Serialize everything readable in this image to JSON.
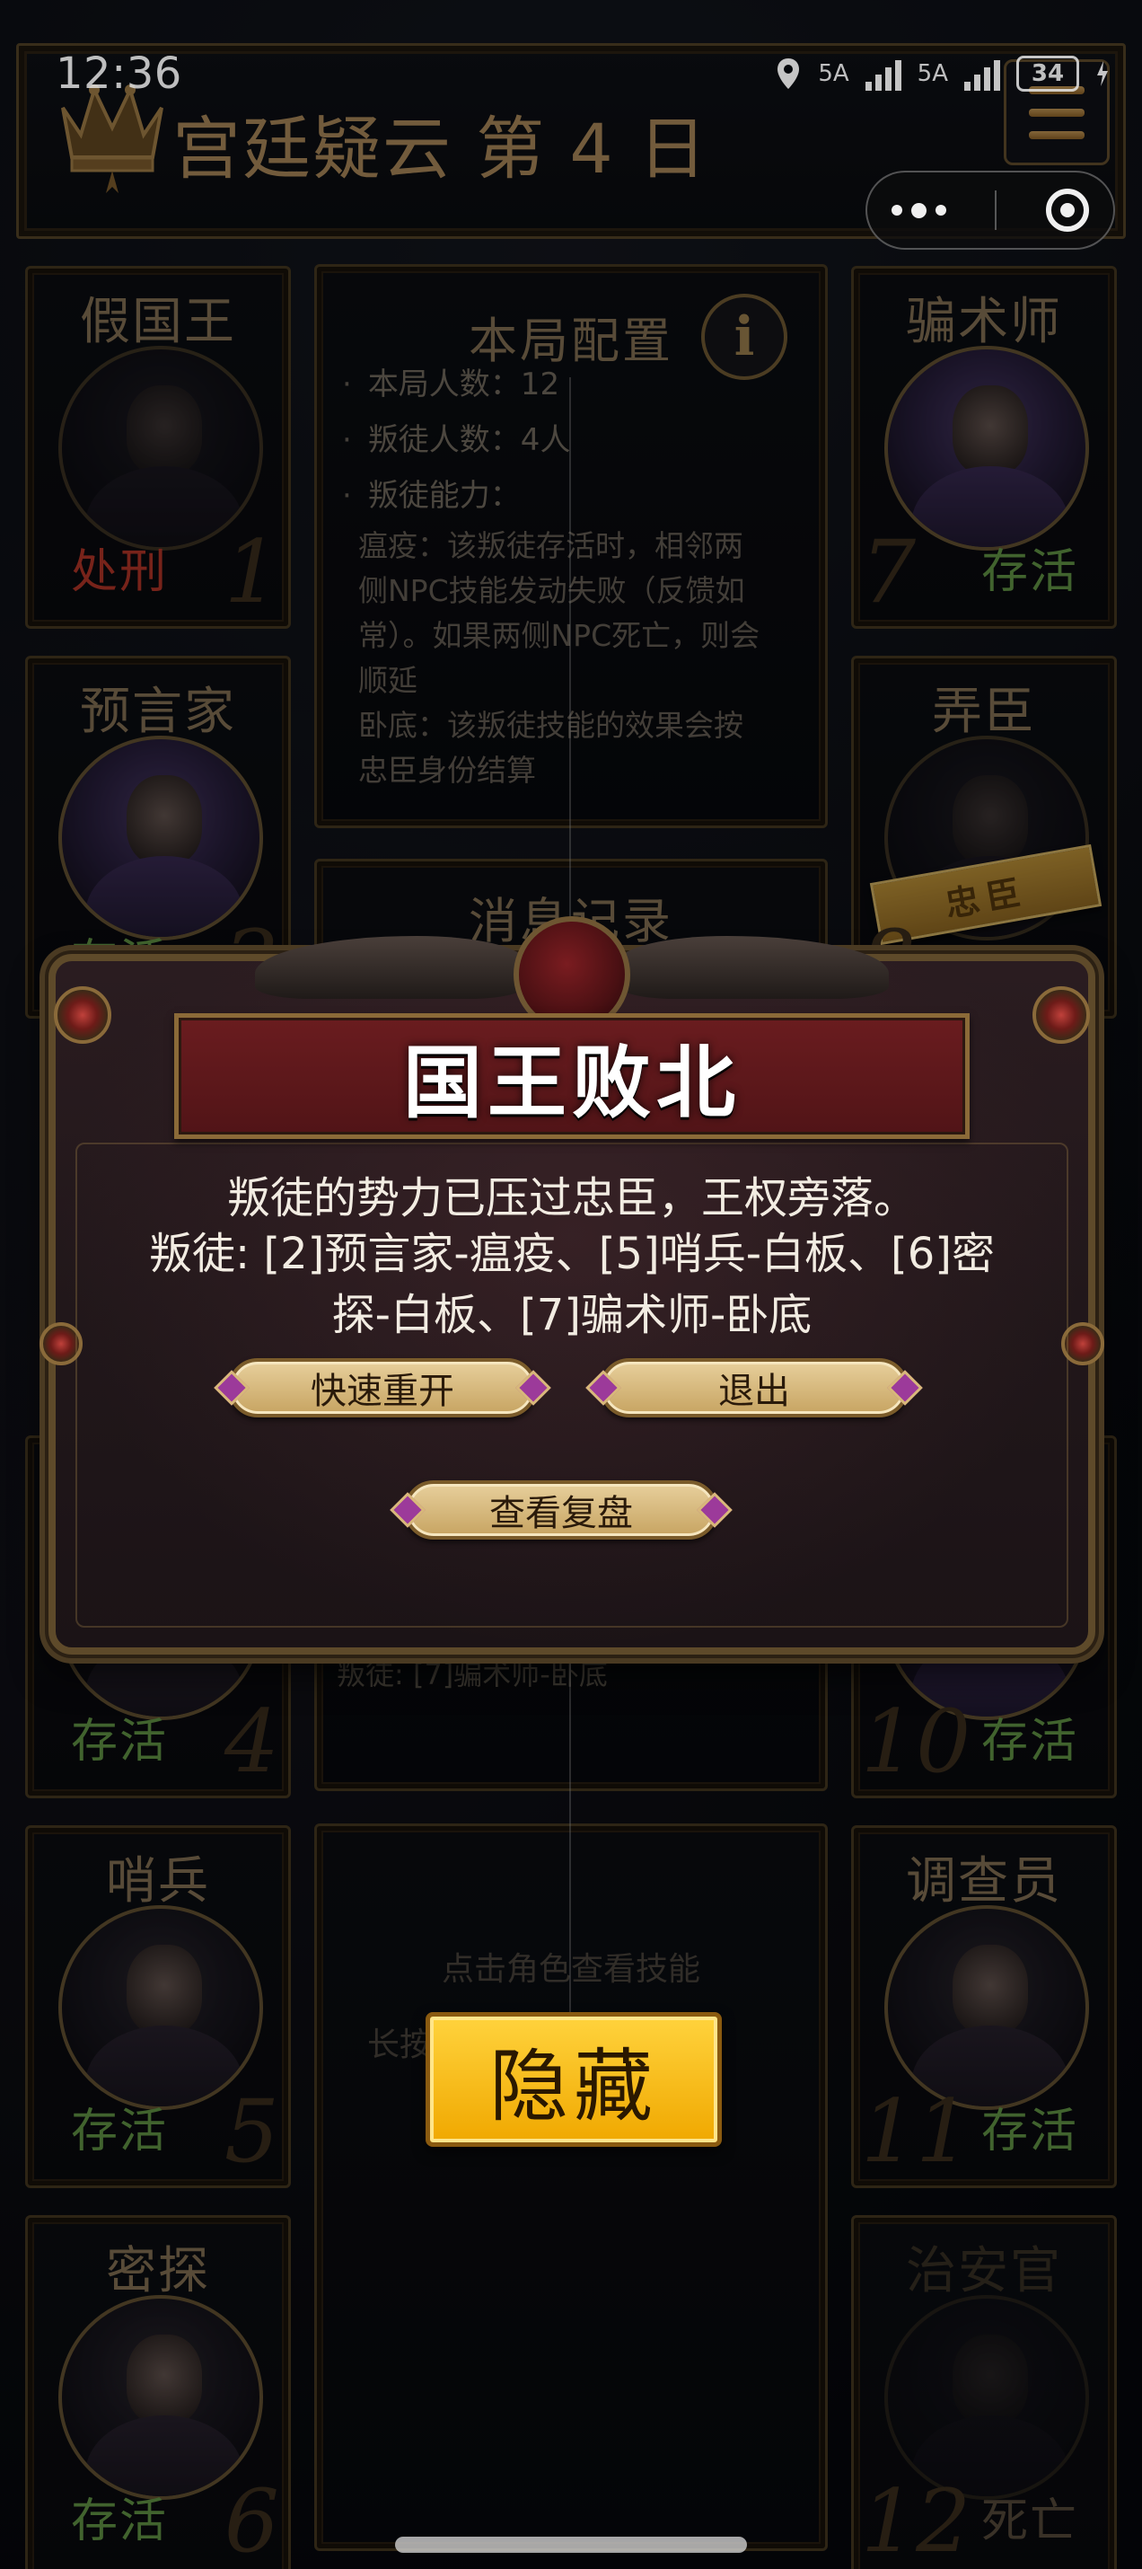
{
  "status_bar": {
    "time": "12:36",
    "network_1": "5A",
    "network_2": "5A",
    "battery": "34"
  },
  "header": {
    "title": "宫廷疑云 第 4 日"
  },
  "config": {
    "title": "本局配置",
    "lines": [
      "本局人数：12",
      "叛徒人数：4人",
      "叛徒能力："
    ],
    "abilities": [
      "瘟疫：该叛徒存活时，相邻两侧NPC技能发动失败（反馈如常）。如果两侧NPC死亡，则会顺延",
      "卧底：该叛徒技能的效果会按忠臣身份结算"
    ]
  },
  "log": {
    "title": "消息记录",
    "partial_line": "叛徒: [7]骗术师-卧底"
  },
  "hint": {
    "line1": "点击角色查看技能",
    "line2": "长按角色标记身份"
  },
  "cards": [
    {
      "name": "假国王",
      "status": "处刑",
      "num": "1"
    },
    {
      "name": "预言家",
      "status": "存活",
      "num": "2"
    },
    {
      "name": "",
      "status": "存活",
      "num": "4"
    },
    {
      "name": "哨兵",
      "status": "存活",
      "num": "5"
    },
    {
      "name": "密探",
      "status": "存活",
      "num": "6"
    },
    {
      "name": "骗术师",
      "status": "存活",
      "num": "7"
    },
    {
      "name": "弄臣",
      "status": "",
      "num": "8",
      "badge": "忠臣"
    },
    {
      "name": "",
      "status": "存活",
      "num": "10"
    },
    {
      "name": "调查员",
      "status": "存活",
      "num": "11"
    },
    {
      "name": "治安官",
      "status": "死亡",
      "num": "12"
    }
  ],
  "dialog": {
    "title": "国王败北",
    "message": "叛徒的势力已压过忠臣，王权旁落。",
    "traitors": "叛徒: [2]预言家-瘟疫、[5]哨兵-白板、[6]密探-白板、[7]骗术师-卧底",
    "restart_label": "快速重开",
    "exit_label": "退出",
    "replay_label": "查看复盘"
  },
  "hide_button_label": "隐藏",
  "icons": {
    "crown": "crown-icon",
    "menu": "menu-icon",
    "info": "info-icon",
    "more": "more-dots-icon",
    "close_target": "target-icon"
  },
  "colors": {
    "gold_text": "#b99462",
    "alive": "#6aa04b",
    "executed": "#c0392b",
    "hide_button": "#f5bd1c",
    "dialog_banner": "#6a1c1f"
  }
}
